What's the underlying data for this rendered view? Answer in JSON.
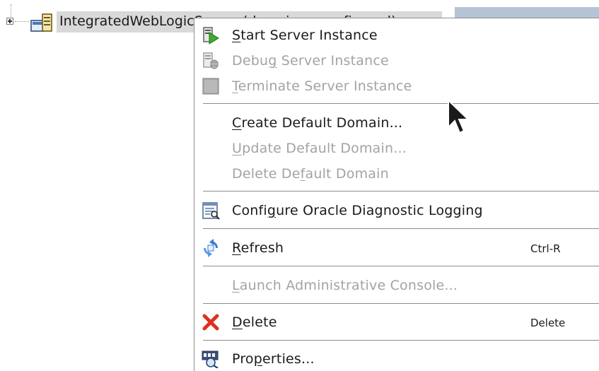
{
  "tree": {
    "node_label": "IntegratedWebLogicServer (domain unconfigured)"
  },
  "menu": {
    "items": [
      {
        "pre": "",
        "mnemonic": "S",
        "post": "tart Server Instance",
        "enabled": true,
        "icon": "start-server-icon"
      },
      {
        "pre": "Debu",
        "mnemonic": "g",
        "post": " Server Instance",
        "enabled": false,
        "icon": "debug-server-icon"
      },
      {
        "pre": "",
        "mnemonic": "T",
        "post": "erminate Server Instance",
        "enabled": false,
        "icon": "terminate-server-icon"
      },
      {
        "pre": "",
        "mnemonic": "C",
        "post": "reate Default Domain...",
        "enabled": true
      },
      {
        "pre": "",
        "mnemonic": "U",
        "post": "pdate Default Domain...",
        "enabled": false
      },
      {
        "pre": "Delete De",
        "mnemonic": "f",
        "post": "ault Domain",
        "enabled": false
      },
      {
        "pre": "Confi",
        "mnemonic": "g",
        "post": "ure Oracle Diagnostic Logging",
        "enabled": true,
        "icon": "diagnostic-logging-icon"
      },
      {
        "pre": "",
        "mnemonic": "R",
        "post": "efresh",
        "enabled": true,
        "icon": "refresh-icon",
        "shortcut": "Ctrl-R"
      },
      {
        "pre": "",
        "mnemonic": "L",
        "post": "aunch Administrative Console...",
        "enabled": false
      },
      {
        "pre": "",
        "mnemonic": "D",
        "post": "elete",
        "enabled": true,
        "icon": "delete-icon",
        "shortcut": "Delete"
      },
      {
        "pre": "Pro",
        "mnemonic": "p",
        "post": "erties...",
        "enabled": true,
        "icon": "properties-icon"
      }
    ]
  },
  "colors": {
    "disabled_text": "#a3a3a3",
    "enabled_text": "#1a1a1a",
    "selection_bg": "#d9d9d9",
    "delete_red": "#e0301e",
    "start_green": "#3cae2c",
    "refresh_blue": "#3a7bd5"
  }
}
